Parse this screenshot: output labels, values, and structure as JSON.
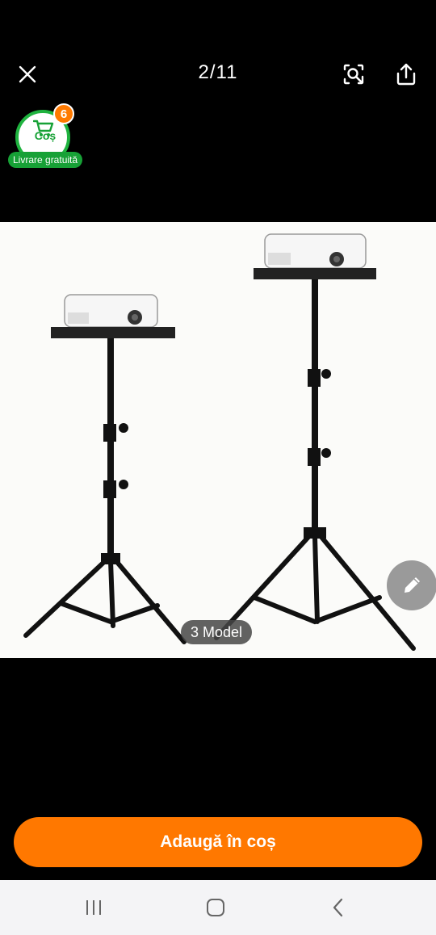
{
  "header": {
    "counter": "2/11",
    "icons": {
      "close": "close-icon",
      "search": "image-search-icon",
      "share": "share-icon"
    }
  },
  "cart": {
    "label": "Coș",
    "count": "6",
    "free_delivery": "Livrare gratuită",
    "colors": {
      "green": "#1fb33f",
      "badge": "#ff7a00"
    }
  },
  "image": {
    "variant_label": "3 Model"
  },
  "actions": {
    "add_to_cart": "Adaugă în coș",
    "edit_icon": "pencil-icon",
    "accent": "#ff7800"
  },
  "system_nav": {
    "recents": "recents-icon",
    "home": "home-icon",
    "back": "back-icon"
  }
}
